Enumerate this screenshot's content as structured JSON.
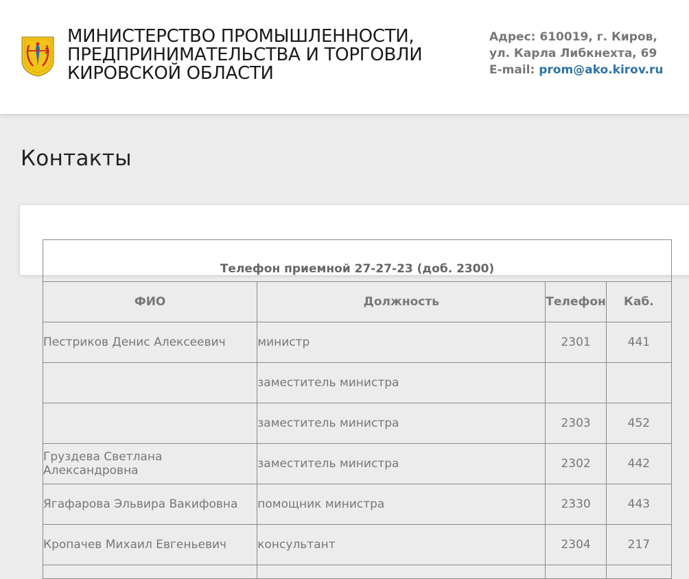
{
  "header": {
    "org_name_lines": [
      "Министерство промышленности,",
      "предпринимательства и торговли",
      "Кировской области"
    ],
    "address_line1": "Адрес: 610019, г. Киров,",
    "address_line2": "ул. Карла Либкнехта, 69",
    "email_label": "E-mail:",
    "email_value": "prom@ako.kirov.ru",
    "emblem_icon": "kirov-oblast-coat-of-arms"
  },
  "page": {
    "title": "Контакты"
  },
  "table": {
    "caption": "Телефон приемной 27-27-23 (доб. 2300)",
    "columns": [
      "ФИО",
      "Должность",
      "Телефон",
      "Каб."
    ],
    "rows": [
      {
        "name": "Пестриков Денис Алексеевич",
        "position": "министр",
        "phone": "2301",
        "room": "441"
      },
      {
        "name": "",
        "position": "заместитель министра",
        "phone": "",
        "room": ""
      },
      {
        "name": "",
        "position": "заместитель министра",
        "phone": "2303",
        "room": "452"
      },
      {
        "name": "Груздева Светлана Александровна",
        "position": "заместитель министра",
        "phone": "2302",
        "room": "442"
      },
      {
        "name": "Ягафарова Эльвира Вакифовна",
        "position": "помощник министра",
        "phone": "2330",
        "room": "443"
      },
      {
        "name": "Кропачев Михаил Евгеньевич",
        "position": "консультант",
        "phone": "2304",
        "room": "217"
      }
    ]
  },
  "colors": {
    "page_bg": "#ececec",
    "header_bg": "#ffffff",
    "link": "#2f72a4",
    "emblem_yellow": "#f2c318",
    "emblem_red": "#c8242b"
  }
}
